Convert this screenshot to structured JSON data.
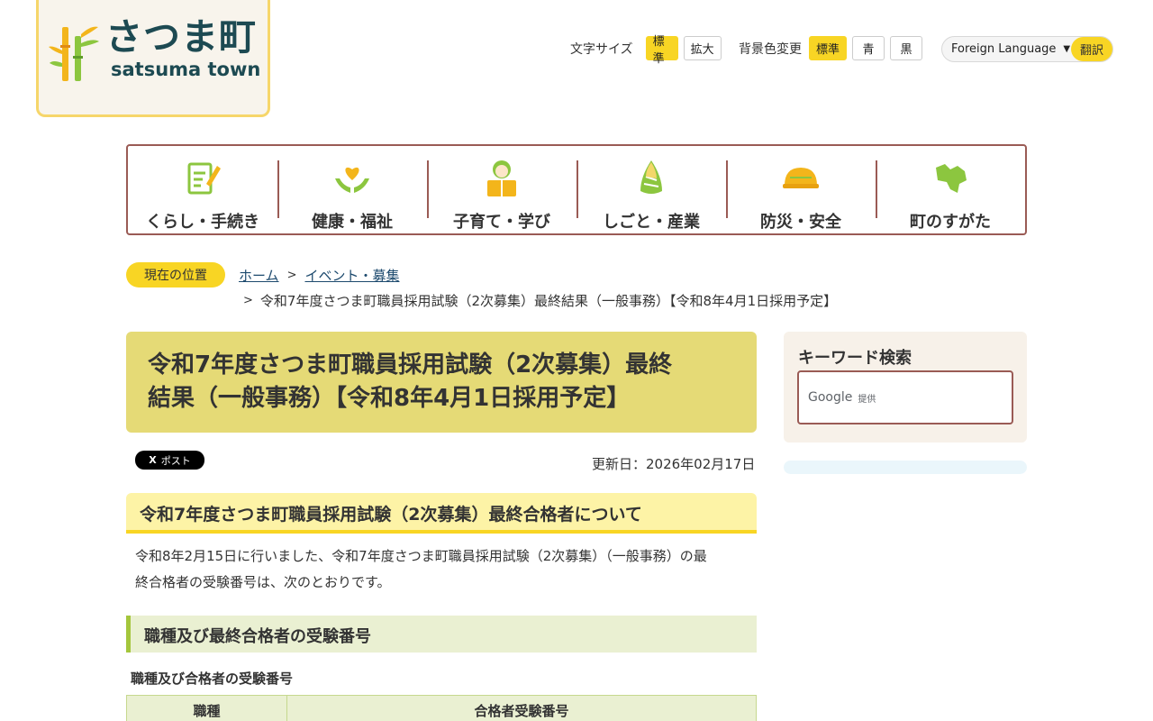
{
  "logo": {
    "jp": "さつま町",
    "en": "satsuma town"
  },
  "utility": {
    "font_size_label": "文字サイズ",
    "font_size_options": [
      "標準",
      "拡大"
    ],
    "bg_label": "背景色変更",
    "bg_options": [
      "標準",
      "青",
      "黒"
    ],
    "language_label": "Foreign Language",
    "translate_label": "翻訳"
  },
  "nav": [
    {
      "label": "くらし・手続き",
      "icon": "document-pen-icon"
    },
    {
      "label": "健康・福祉",
      "icon": "heart-hands-icon"
    },
    {
      "label": "子育て・学び",
      "icon": "child-reading-icon"
    },
    {
      "label": "しごと・産業",
      "icon": "bamboo-shoot-icon"
    },
    {
      "label": "防災・安全",
      "icon": "helmet-icon"
    },
    {
      "label": "町のすがた",
      "icon": "town-map-icon"
    }
  ],
  "breadcrumb": {
    "badge": "現在の位置",
    "items": [
      "ホーム",
      "イベント・募集"
    ],
    "current": "令和7年度さつま町職員採用試験（2次募集）最終結果（一般事務）【令和8年4月1日採用予定】"
  },
  "page": {
    "title_line1": "令和7年度さつま町職員採用試験（2次募集）最終",
    "title_line2": "結果（一般事務）【令和8年4月1日採用予定】",
    "post_label": "ポスト",
    "updated": "更新日：2026年02月17日",
    "section_heading": "令和7年度さつま町職員採用試験（2次募集）最終合格者について",
    "paragraph_line1": "令和8年2月15日に行いました、令和7年度さつま町職員採用試験（2次募集）（一般事務）の最",
    "paragraph_line2": "終合格者の受験番号は、次のとおりです。",
    "sub_heading": "職種及び最終合格者の受験番号",
    "table_caption": "職種及び合格者の受験番号",
    "table_headers": [
      "職種",
      "合格者受験番号"
    ]
  },
  "sidebar": {
    "search_title": "キーワード検索",
    "google_brand": "Google",
    "google_sub": "提供"
  },
  "colors": {
    "accent_yellow": "#f8d524",
    "nav_border": "#9a5b55",
    "title_bg": "#e5da76",
    "logo_text": "#1d4a52",
    "green_accent": "#a4c63c"
  }
}
